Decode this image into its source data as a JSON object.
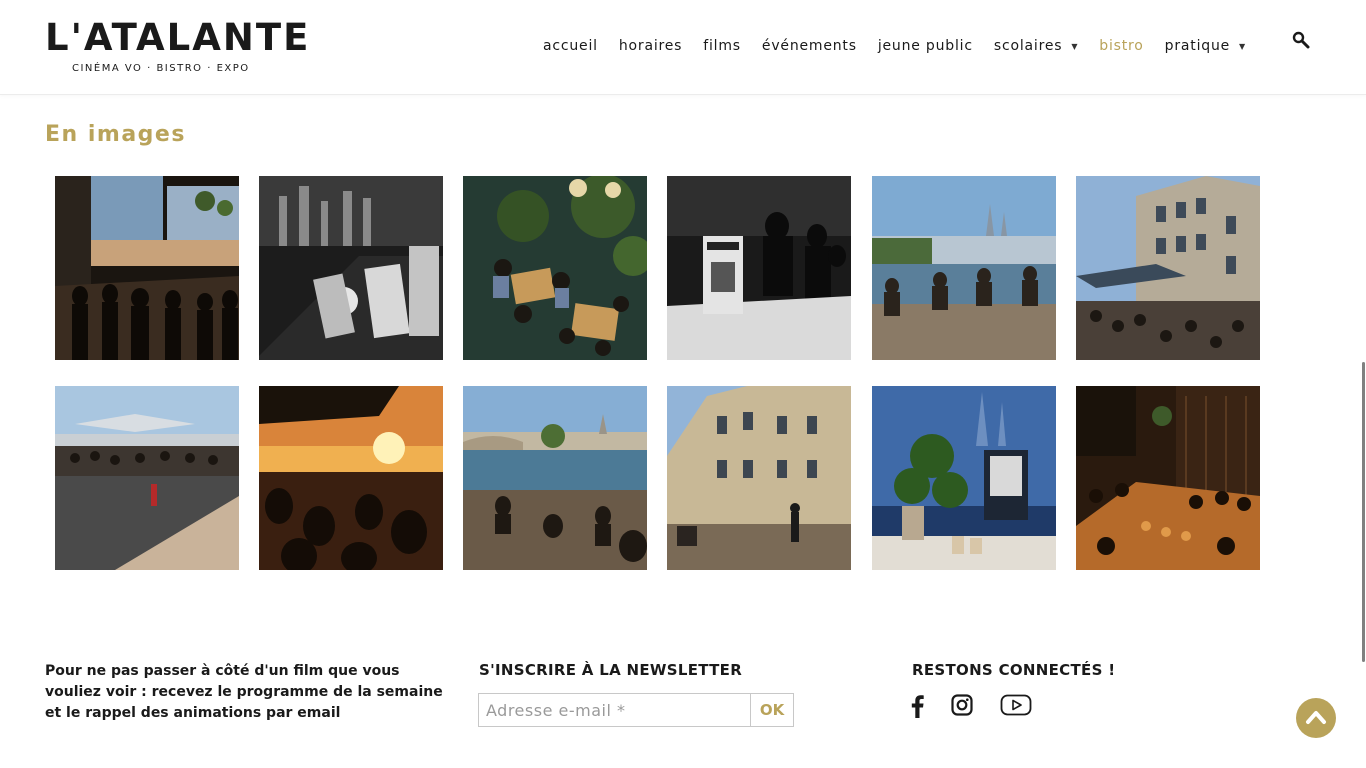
{
  "brand": {
    "name": "L'ATALANTE",
    "tagline": "CINÉMA VO · BISTRO · EXPO"
  },
  "nav": {
    "items": [
      {
        "label": "accueil"
      },
      {
        "label": "horaires"
      },
      {
        "label": "films"
      },
      {
        "label": "événements"
      },
      {
        "label": "jeune public"
      },
      {
        "label": "scolaires",
        "dropdown": true
      },
      {
        "label": "bistro",
        "active": true
      },
      {
        "label": "pratique",
        "dropdown": true
      }
    ],
    "search_icon": "search-icon"
  },
  "section": {
    "title": "En images"
  },
  "gallery": {
    "photos": [
      {
        "subject": "bistro-windows-crowd-photo"
      },
      {
        "subject": "bar-bottles-bw-photo"
      },
      {
        "subject": "bistro-tables-overhead-photo"
      },
      {
        "subject": "bistro-interior-bw-photo"
      },
      {
        "subject": "riverbank-people-photo"
      },
      {
        "subject": "terrace-street-photo"
      },
      {
        "subject": "terrace-umbrellas-photo"
      },
      {
        "subject": "sunset-terrace-photo"
      },
      {
        "subject": "river-bridge-photo"
      },
      {
        "subject": "street-building-runner-photo"
      },
      {
        "subject": "window-plant-photo"
      },
      {
        "subject": "crowded-bar-photo"
      }
    ]
  },
  "footer": {
    "newsletter_text": "Pour ne pas passer à côté d'un film que vous vouliez voir : recevez le programme de la semaine et le rappel des animations par email",
    "newsletter_title": "S'INSCRIRE À LA NEWSLETTER",
    "email_placeholder": "Adresse e-mail *",
    "ok_label": "OK",
    "social_title": "RESTONS CONNECTÉS !",
    "social_icons": [
      "facebook-icon",
      "instagram-icon",
      "youtube-icon"
    ]
  },
  "colors": {
    "accent": "#b9a35a",
    "text": "#1a1a1a",
    "background": "#ffffff"
  }
}
